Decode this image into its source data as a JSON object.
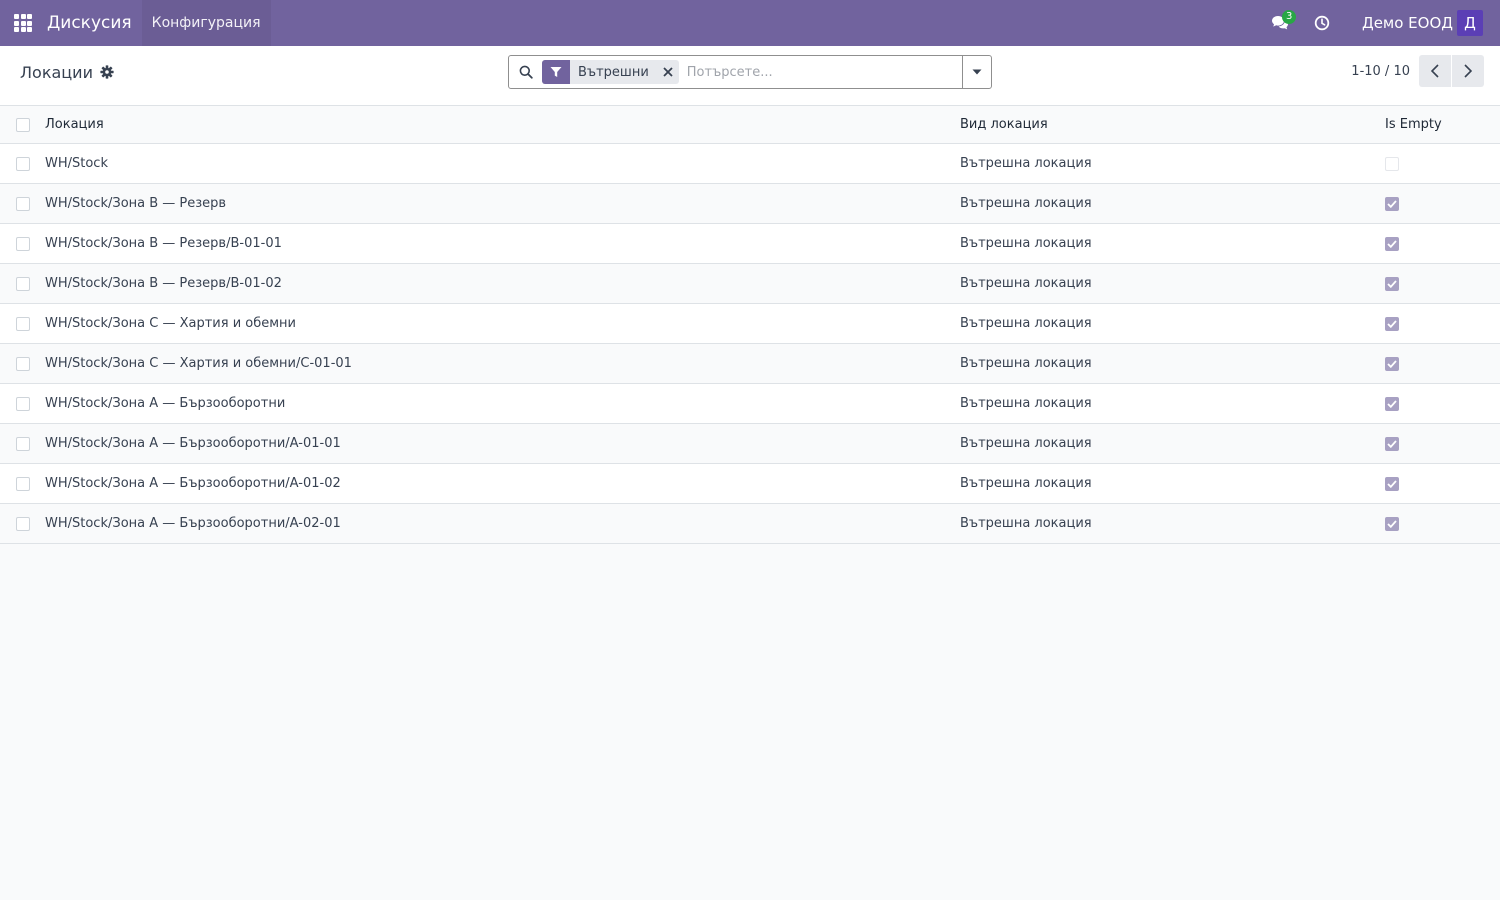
{
  "navbar": {
    "brand": "Дискусия",
    "menu_config": "Конфигурация",
    "chat_count": "3",
    "company": "Демо ЕООД",
    "avatar_letter": "Д"
  },
  "control": {
    "title": "Локации",
    "facet_label": "Вътрешни",
    "search_placeholder": "Потърсете...",
    "pager_value": "1-10 / 10"
  },
  "table": {
    "headers": {
      "name": "Локация",
      "type": "Вид локация",
      "is_empty": "Is Empty"
    },
    "rows": [
      {
        "name": "WH/Stock",
        "type": "Вътрешна локация",
        "is_empty": false
      },
      {
        "name": "WH/Stock/Зона B — Резерв",
        "type": "Вътрешна локация",
        "is_empty": true
      },
      {
        "name": "WH/Stock/Зона B — Резерв/B-01-01",
        "type": "Вътрешна локация",
        "is_empty": true
      },
      {
        "name": "WH/Stock/Зона B — Резерв/B-01-02",
        "type": "Вътрешна локация",
        "is_empty": true
      },
      {
        "name": "WH/Stock/Зона C — Хартия и обемни",
        "type": "Вътрешна локация",
        "is_empty": true
      },
      {
        "name": "WH/Stock/Зона C — Хартия и обемни/C-01-01",
        "type": "Вътрешна локация",
        "is_empty": true
      },
      {
        "name": "WH/Stock/Зона A — Бързооборотни",
        "type": "Вътрешна локация",
        "is_empty": true
      },
      {
        "name": "WH/Stock/Зона A — Бързооборотни/A-01-01",
        "type": "Вътрешна локация",
        "is_empty": true
      },
      {
        "name": "WH/Stock/Зона A — Бързооборотни/A-01-02",
        "type": "Вътрешна локация",
        "is_empty": true
      },
      {
        "name": "WH/Stock/Зона A — Бързооборотни/A-02-01",
        "type": "Вътрешна локация",
        "is_empty": true
      }
    ]
  },
  "colors": {
    "navbar": "#71639e",
    "checked": "#a8a1c3",
    "chat_badge": "#28a745",
    "avatar": "#5b3fb5"
  }
}
